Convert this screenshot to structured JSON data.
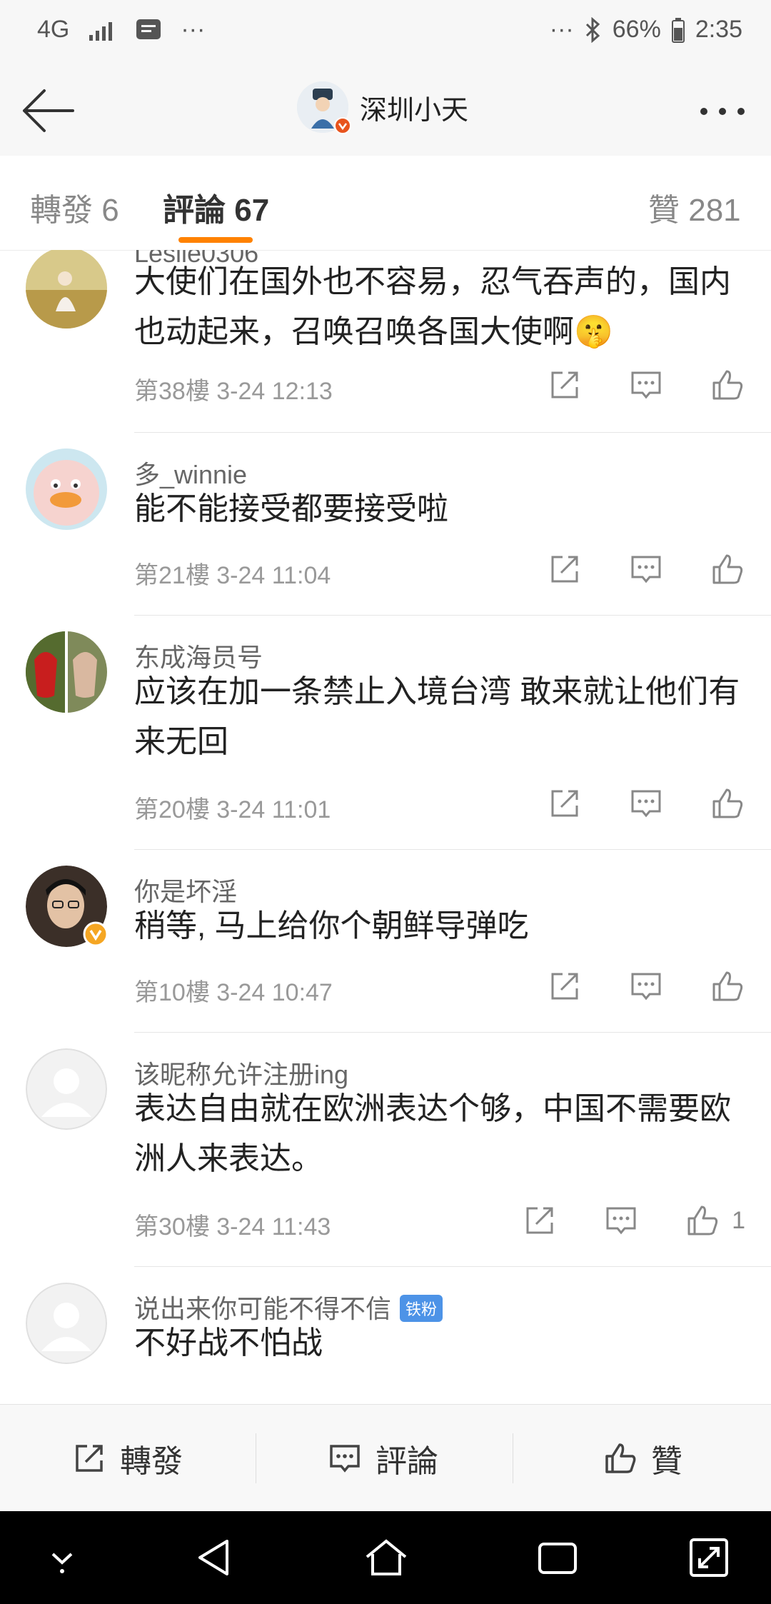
{
  "status_bar": {
    "network": "4G",
    "dots_left": "···",
    "dots_right": "···",
    "battery": "66%",
    "time": "2:35"
  },
  "nav": {
    "title": "深圳小天"
  },
  "tabs": {
    "repost": "轉發 6",
    "comments": "評論 67",
    "likes": "贊 281"
  },
  "comments": [
    {
      "name": "Leslie0306",
      "text": "大使们在国外也不容易，忍气吞声的，国内也动起来，召唤召唤各国大使啊🤫",
      "floor_time": "第38樓 3-24 12:13",
      "likes": ""
    },
    {
      "name": "多_winnie",
      "text": "能不能接受都要接受啦",
      "floor_time": "第21樓 3-24 11:04",
      "likes": ""
    },
    {
      "name": "东成海员号",
      "text": "应该在加一条禁止入境台湾 敢来就让他们有来无回",
      "floor_time": "第20樓 3-24 11:01",
      "likes": ""
    },
    {
      "name": "你是坏淫",
      "text": "稍等, 马上给你个朝鲜导弹吃",
      "floor_time": "第10樓 3-24 10:47",
      "likes": ""
    },
    {
      "name": "该昵称允许注册ing",
      "text": "表达自由就在欧洲表达个够，中国不需要欧洲人来表达。",
      "floor_time": "第30樓 3-24 11:43",
      "likes": "1"
    },
    {
      "name": "说出来你可能不得不信",
      "badge": "铁粉",
      "text": "不好战不怕战",
      "floor_time": "",
      "likes": ""
    }
  ],
  "bottom_bar": {
    "repost": "轉發",
    "comment": "評論",
    "like": "贊"
  },
  "colors": {
    "accent": "#ff8200",
    "verified": "#f5a623",
    "fan_badge": "#4d93e7"
  }
}
